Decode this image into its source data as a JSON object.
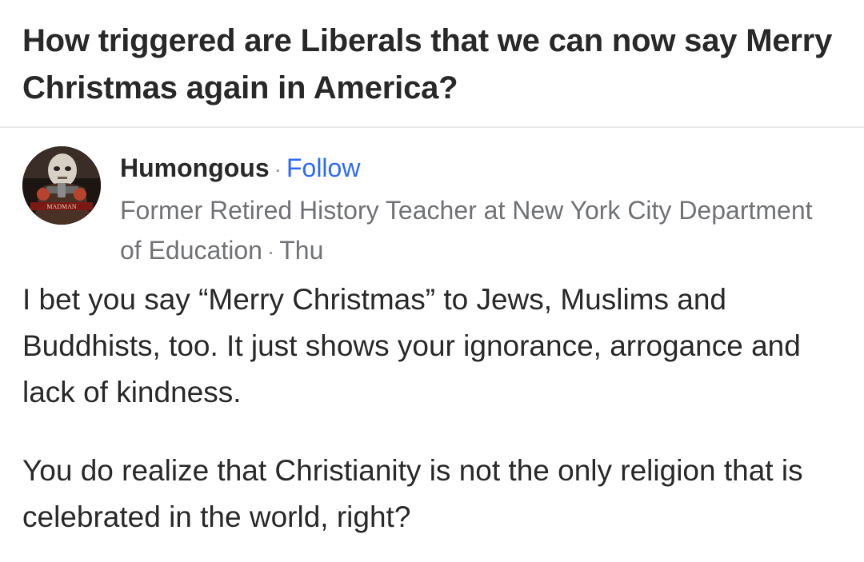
{
  "question": {
    "title": "How triggered are Liberals that we can now say Merry Christmas again in America?"
  },
  "author": {
    "name": "Humongous",
    "separator": "·",
    "follow_label": "Follow",
    "avatar_icon": "masked-man-avatar-icon",
    "avatar_caption": "MADMAN",
    "credential": "Former Retired History Teacher at New York City Department of Education",
    "timestamp": "Thu"
  },
  "answer": {
    "paragraphs": [
      "I bet you say “Merry Christmas” to Jews, Muslims and Buddhists, too. It just shows your ignorance, arrogance and lack of kindness.",
      "You do realize that Christianity is not the only religion that is celebrated in the world, right?"
    ]
  },
  "colors": {
    "text": "#282829",
    "secondary_text": "#6f7174",
    "link": "#2e69ff",
    "divider": "#e8e8e8"
  }
}
